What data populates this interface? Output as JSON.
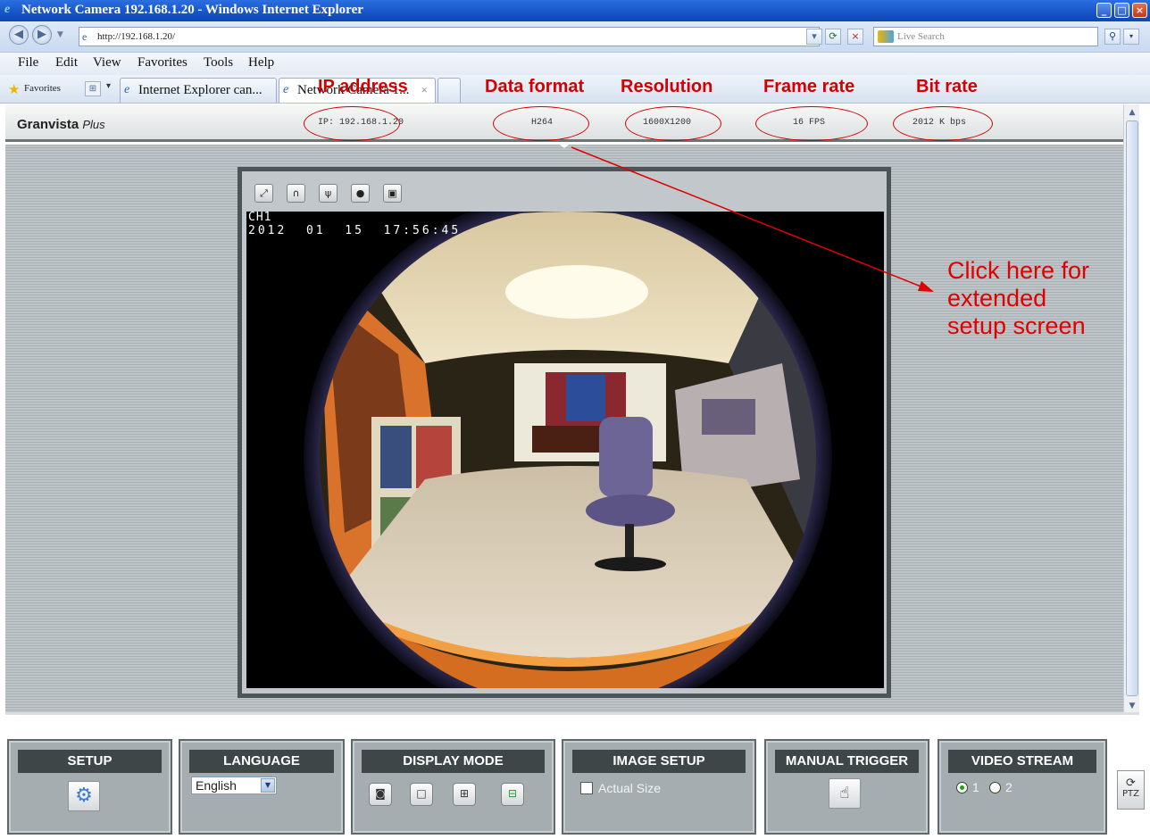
{
  "window": {
    "title": "Network Camera 192.168.1.20 - Windows Internet Explorer",
    "minimize": "_",
    "maximize": "□",
    "close": "×"
  },
  "address_bar": {
    "url": "http://192.168.1.20/",
    "search_placeholder": "Live Search"
  },
  "menu": [
    "File",
    "Edit",
    "View",
    "Favorites",
    "Tools",
    "Help"
  ],
  "favorites_bar": {
    "label": "Favorites",
    "tabs": [
      {
        "label": "Internet Explorer can..."
      },
      {
        "label": "Network Camera 1..."
      }
    ]
  },
  "annotations": {
    "ip_address": "IP address",
    "data_format": "Data format",
    "resolution": "Resolution",
    "frame_rate": "Frame rate",
    "bit_rate": "Bit rate",
    "callout": [
      "Click here for",
      "extended",
      "setup screen"
    ]
  },
  "camera_page": {
    "brand": "Granvista",
    "brand_suffix": "Plus",
    "ip": "IP: 192.168.1.20",
    "format": "H264",
    "resolution": "1600X1200",
    "fps": "16  FPS",
    "bitrate": "2012  K bps",
    "osd_channel": "CH1",
    "osd_timestamp": "2012  01  15  17:56:45"
  },
  "panels": {
    "setup": {
      "title": "SETUP"
    },
    "language": {
      "title": "LANGUAGE",
      "selected": "English"
    },
    "display_mode": {
      "title": "DISPLAY MODE"
    },
    "image_setup": {
      "title": "IMAGE SETUP",
      "actual_size": "Actual Size"
    },
    "manual_trigger": {
      "title": "MANUAL TRIGGER"
    },
    "video_stream": {
      "title": "VIDEO STREAM",
      "options": [
        "1",
        "2"
      ],
      "selected": "1"
    },
    "ptz": "PTZ"
  },
  "colors": {
    "annotation": "#d20000",
    "panel_bg": "#a6adb1",
    "panel_title_bg": "#3e4648",
    "ie_blue": "#1654c8"
  }
}
